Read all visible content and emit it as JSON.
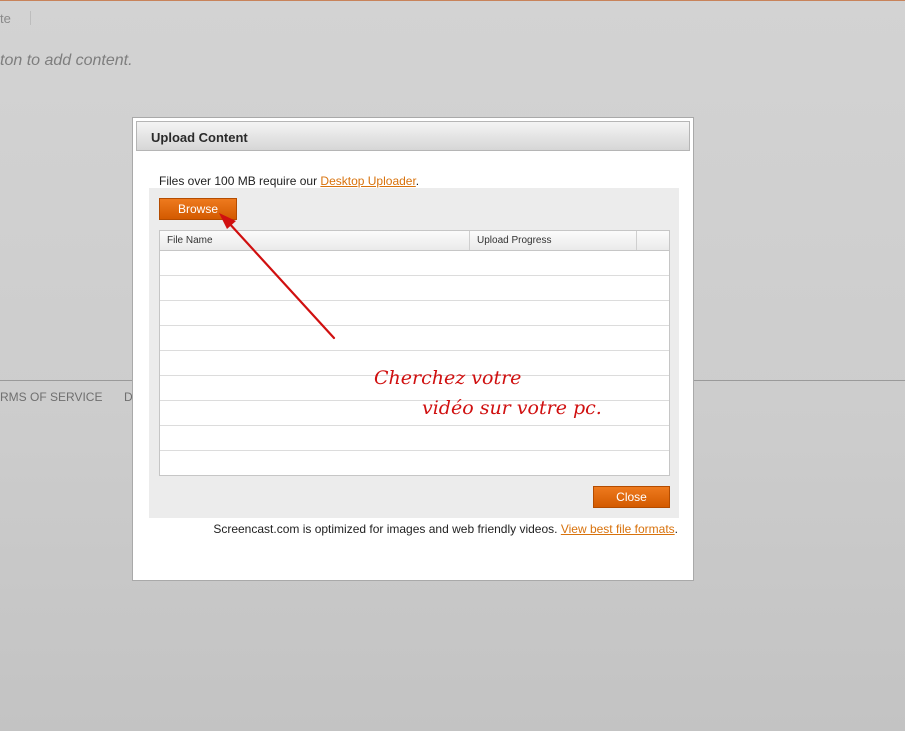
{
  "background": {
    "nav_text": "te",
    "hint_text": "ton to add content.",
    "footer_terms": "RMS OF SERVICE",
    "footer_partial": "D"
  },
  "dialog": {
    "title": "Upload Content",
    "notice_prefix": "Files over 100 MB require our ",
    "notice_link": "Desktop Uploader",
    "notice_suffix": ".",
    "browse_label": "Browse",
    "close_label": "Close",
    "table": {
      "columns": [
        "File Name",
        "Upload Progress"
      ],
      "rows": [
        [],
        [],
        [],
        [],
        [],
        [],
        [],
        [],
        []
      ]
    },
    "footer_text": "Screencast.com is optimized for images and web friendly videos. ",
    "footer_link": "View best file formats",
    "footer_suffix": "."
  },
  "annotation": {
    "line1": "Cherchez votre",
    "line2": "vidéo sur votre pc.",
    "color": "#d01010"
  },
  "colors": {
    "accent": "#e0660f",
    "link": "#d8720c"
  }
}
